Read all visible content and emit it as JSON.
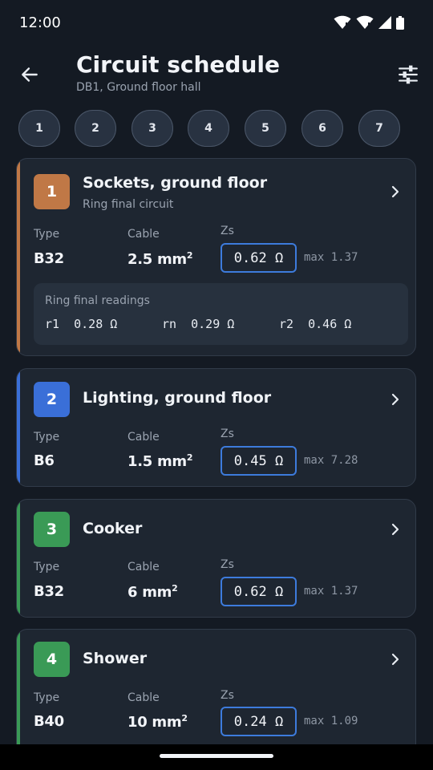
{
  "status": {
    "time": "12:00"
  },
  "appbar": {
    "title": "Circuit schedule",
    "subtitle": "DB1, Ground floor hall"
  },
  "chips": [
    "1",
    "2",
    "3",
    "4",
    "5",
    "6",
    "7"
  ],
  "labels": {
    "type": "Type",
    "cable": "Cable",
    "zs": "Zs",
    "max_prefix": "max"
  },
  "colors": {
    "orange": "#c07846",
    "blue": "#3a6fd8",
    "green": "#3a9a56",
    "focus": "#3d7bdc"
  },
  "circuits": [
    {
      "number": "1",
      "name": "Sockets, ground floor",
      "subtitle": "Ring final circuit",
      "type": "B32",
      "cable": "2.5 mm",
      "cable_sup": "2",
      "zs": "0.62 Ω",
      "zs_max": "max 1.37",
      "accent": "orange",
      "ring": {
        "title": "Ring final readings",
        "r1": "r1  0.28 Ω",
        "rn": "rn  0.29 Ω",
        "r2": "r2  0.46 Ω"
      }
    },
    {
      "number": "2",
      "name": "Lighting, ground floor",
      "subtitle": "",
      "type": "B6",
      "cable": "1.5 mm",
      "cable_sup": "2",
      "zs": "0.45 Ω",
      "zs_max": "max 7.28",
      "accent": "blue"
    },
    {
      "number": "3",
      "name": "Cooker",
      "subtitle": "",
      "type": "B32",
      "cable": "6 mm",
      "cable_sup": "2",
      "zs": "0.62 Ω",
      "zs_max": "max 1.37",
      "accent": "green"
    },
    {
      "number": "4",
      "name": "Shower",
      "subtitle": "",
      "type": "B40",
      "cable": "10 mm",
      "cable_sup": "2",
      "zs": "0.24 Ω",
      "zs_max": "max 1.09",
      "accent": "green"
    }
  ]
}
